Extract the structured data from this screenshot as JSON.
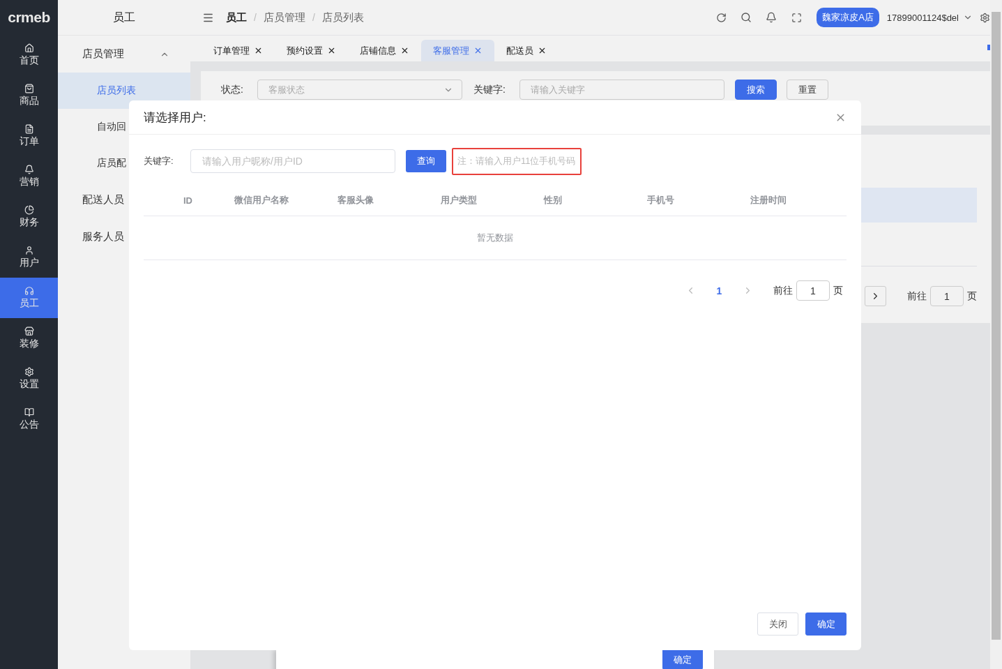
{
  "sidebar": {
    "logo": "crmeb",
    "items": [
      {
        "label": "首页",
        "selected": false
      },
      {
        "label": "商品",
        "selected": false
      },
      {
        "label": "订单",
        "selected": false
      },
      {
        "label": "营销",
        "selected": false
      },
      {
        "label": "财务",
        "selected": false
      },
      {
        "label": "用户",
        "selected": false
      },
      {
        "label": "员工",
        "selected": true
      },
      {
        "label": "装修",
        "selected": false
      },
      {
        "label": "设置",
        "selected": false
      },
      {
        "label": "公告",
        "selected": false
      }
    ]
  },
  "submenu": {
    "title": "员工",
    "items": [
      {
        "label": "店员管理",
        "expanded": true,
        "children": [
          {
            "label": "店员列表",
            "selected": true
          },
          {
            "label": "自动回",
            "selected": false
          },
          {
            "label": "店员配",
            "selected": false
          }
        ]
      },
      {
        "label": "配送人员",
        "selected": false
      },
      {
        "label": "服务人员",
        "selected": false
      }
    ]
  },
  "header": {
    "breadcrumb": [
      "员工",
      "店员管理",
      "店员列表"
    ],
    "breadcrumb_separator": "/",
    "store_badge": "魏家凉皮A店",
    "user": "17899001124$del"
  },
  "tabs": [
    {
      "label": "订单管理",
      "selected": false
    },
    {
      "label": "预约设置",
      "selected": false
    },
    {
      "label": "店铺信息",
      "selected": false
    },
    {
      "label": "客服管理",
      "selected": true
    },
    {
      "label": "配送员",
      "selected": false
    }
  ],
  "page": {
    "filter": {
      "status_label": "状态:",
      "status_placeholder": "客服状态",
      "keyword_label": "关键字:",
      "keyword_placeholder": "请输入关键字",
      "search_button": "搜索",
      "reset_button": "重置"
    },
    "pagination": {
      "goto_label": "前往",
      "page_value": "1",
      "page_suffix": "页"
    }
  },
  "back_dialog": {
    "confirm_button": "确定"
  },
  "modal": {
    "title": "请选择用户:",
    "keyword_label": "关键字:",
    "keyword_placeholder": "请输入用户昵称/用户ID",
    "query_button": "查询",
    "note": "注：请输入用户11位手机号码",
    "columns": [
      "ID",
      "微信用户名称",
      "客服头像",
      "用户类型",
      "性别",
      "手机号",
      "注册时间"
    ],
    "empty_text": "暂无数据",
    "pagination": {
      "pages": [
        {
          "label": "1",
          "selected": true
        }
      ],
      "goto_label": "前往",
      "page_value": "1",
      "page_suffix": "页"
    },
    "close_button": "关闭",
    "confirm_button": "确定"
  }
}
